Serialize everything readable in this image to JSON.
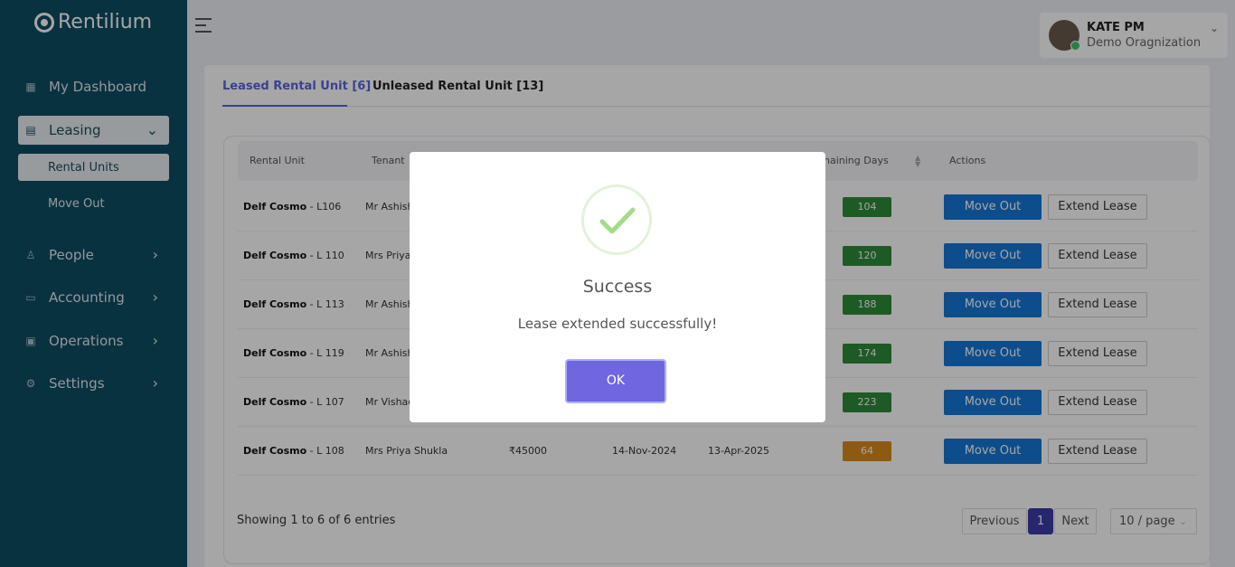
{
  "app": {
    "logo_text": "Rentilium"
  },
  "sidebar": {
    "items": [
      {
        "label": "My Dashboard",
        "icon": "dashboard-icon"
      },
      {
        "label": "Leasing",
        "icon": "leasing-icon"
      },
      {
        "label": "People",
        "icon": "people-icon"
      },
      {
        "label": "Accounting",
        "icon": "accounting-icon"
      },
      {
        "label": "Operations",
        "icon": "operations-icon"
      },
      {
        "label": "Settings",
        "icon": "gear-icon"
      }
    ],
    "leasing_sub": [
      {
        "label": "Rental Units",
        "active": true
      },
      {
        "label": "Move Out",
        "active": false
      }
    ]
  },
  "header": {
    "user_name": "KATE PM",
    "user_org": "Demo Oragnization"
  },
  "tabs": [
    {
      "label": "Leased Rental Unit [6]",
      "active": true
    },
    {
      "label": "Unleased Rental Unit [13]",
      "active": false
    }
  ],
  "table": {
    "columns": [
      "Rental Unit",
      "Tenant",
      "naining Days",
      "Actions"
    ],
    "rows": [
      {
        "unit": "Delf Cosmo",
        "unit_code": " - L106",
        "tenant": "Mr Ashish",
        "rent": "",
        "start": "",
        "end": "",
        "days": "104",
        "status_color": "#2e8b3a"
      },
      {
        "unit": "Delf Cosmo",
        "unit_code": " - L 110",
        "tenant": "Mrs Priya",
        "rent": "",
        "start": "",
        "end": "",
        "days": "120",
        "status_color": "#2e8b3a"
      },
      {
        "unit": "Delf Cosmo",
        "unit_code": " - L 113",
        "tenant": "Mr Ashish",
        "rent": "",
        "start": "",
        "end": "",
        "days": "188",
        "status_color": "#2e8b3a"
      },
      {
        "unit": "Delf Cosmo",
        "unit_code": " - L 119",
        "tenant": "Mr Ashish",
        "rent": "",
        "start": "",
        "end": "",
        "days": "174",
        "status_color": "#2e8b3a"
      },
      {
        "unit": "Delf Cosmo",
        "unit_code": " - L 107",
        "tenant": "Mr Vishac",
        "rent": "",
        "start": "",
        "end": "",
        "days": "223",
        "status_color": "#2e8b3a"
      },
      {
        "unit": "Delf Cosmo",
        "unit_code": " - L 108",
        "tenant": "Mrs Priya Shukla",
        "rent": "₹45000",
        "start": "14-Nov-2024",
        "end": "13-Apr-2025",
        "days": "64",
        "status_color": "#d98a1f"
      }
    ],
    "move_out_label": "Move Out",
    "extend_label": "Extend Lease"
  },
  "footer": {
    "showing": "Showing 1 to 6 of 6 entries",
    "previous": "Previous",
    "page": "1",
    "next": "Next",
    "page_size": "10 / page"
  },
  "modal": {
    "title": "Success",
    "message": "Lease extended successfully!",
    "ok_label": "OK"
  }
}
